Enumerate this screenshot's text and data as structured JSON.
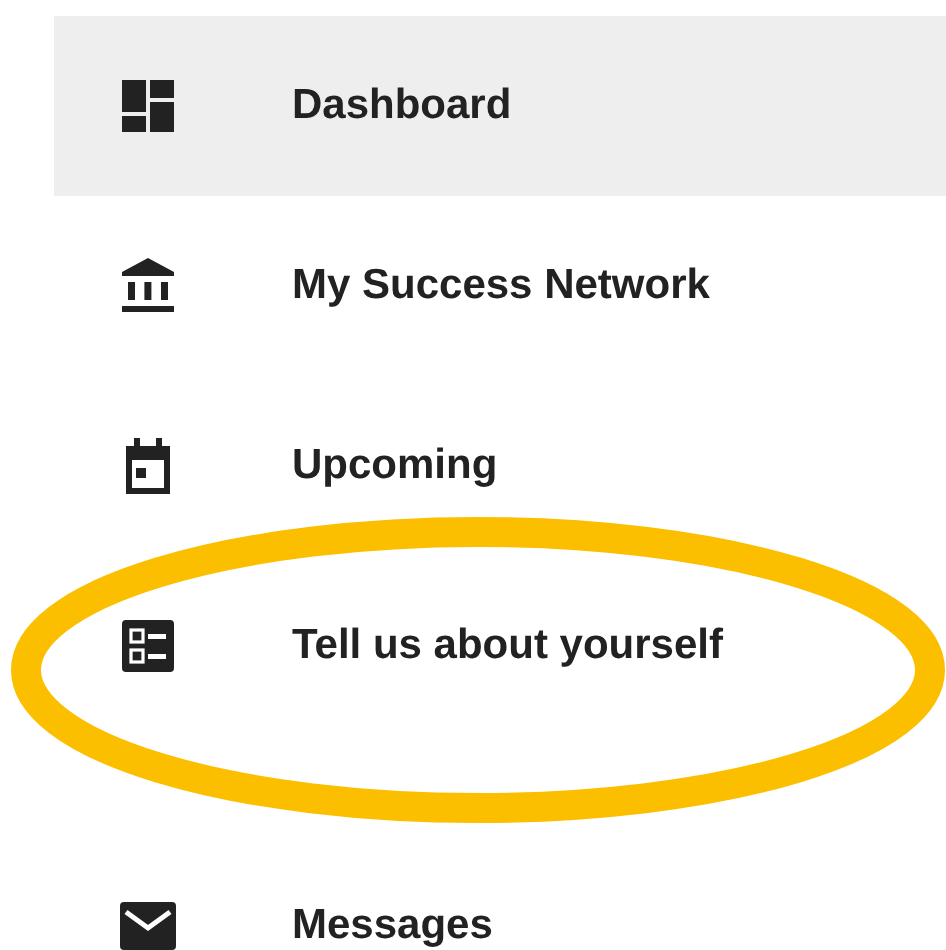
{
  "nav": {
    "items": [
      {
        "kind": "dashboard",
        "label": "Dashboard",
        "selected": true,
        "circled": false
      },
      {
        "kind": "network",
        "label": "My Success Network",
        "selected": false,
        "circled": false
      },
      {
        "kind": "calendar",
        "label": "Upcoming",
        "selected": false,
        "circled": false
      },
      {
        "kind": "form",
        "label": "Tell us about yourself",
        "selected": false,
        "circled": true
      },
      {
        "kind": "mail",
        "label": "Messages",
        "selected": false,
        "circled": false
      }
    ]
  }
}
